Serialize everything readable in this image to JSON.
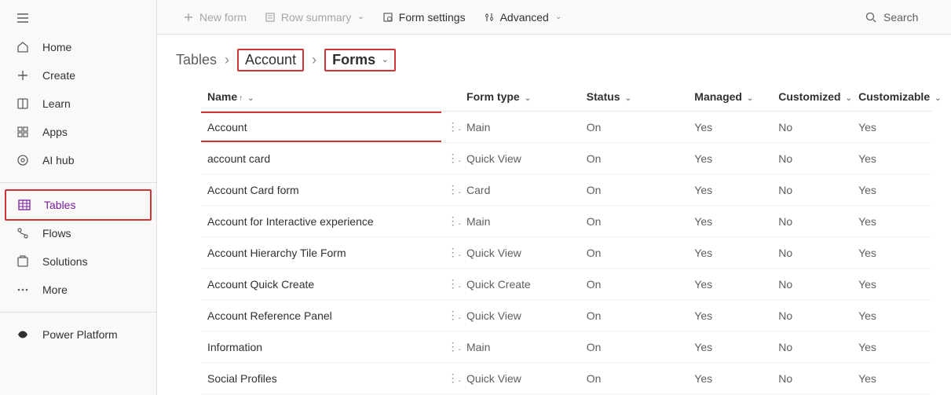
{
  "sidebar": {
    "items": [
      {
        "label": "Home",
        "icon": "home-icon"
      },
      {
        "label": "Create",
        "icon": "plus-icon"
      },
      {
        "label": "Learn",
        "icon": "book-icon"
      },
      {
        "label": "Apps",
        "icon": "apps-icon"
      },
      {
        "label": "AI hub",
        "icon": "aihub-icon"
      },
      {
        "label": "Tables",
        "icon": "tables-icon",
        "selected": true,
        "highlighted": true
      },
      {
        "label": "Flows",
        "icon": "flows-icon"
      },
      {
        "label": "Solutions",
        "icon": "solutions-icon"
      },
      {
        "label": "More",
        "icon": "more-icon"
      },
      {
        "label": "Power Platform",
        "icon": "powerplatform-icon"
      }
    ]
  },
  "commandbar": {
    "new_form": "New form",
    "row_summary": "Row summary",
    "form_settings": "Form settings",
    "advanced": "Advanced",
    "search_placeholder": "Search"
  },
  "breadcrumb": {
    "root": "Tables",
    "lvl1": "Account",
    "lvl2": "Forms"
  },
  "table": {
    "columns": {
      "name": "Name",
      "form_type": "Form type",
      "status": "Status",
      "managed": "Managed",
      "customized": "Customized",
      "customizable": "Customizable"
    },
    "rows": [
      {
        "name": "Account",
        "form_type": "Main",
        "status": "On",
        "managed": "Yes",
        "customized": "No",
        "customizable": "Yes",
        "highlighted": true
      },
      {
        "name": "account card",
        "form_type": "Quick View",
        "status": "On",
        "managed": "Yes",
        "customized": "No",
        "customizable": "Yes"
      },
      {
        "name": "Account Card form",
        "form_type": "Card",
        "status": "On",
        "managed": "Yes",
        "customized": "No",
        "customizable": "Yes"
      },
      {
        "name": "Account for Interactive experience",
        "form_type": "Main",
        "status": "On",
        "managed": "Yes",
        "customized": "No",
        "customizable": "Yes"
      },
      {
        "name": "Account Hierarchy Tile Form",
        "form_type": "Quick View",
        "status": "On",
        "managed": "Yes",
        "customized": "No",
        "customizable": "Yes"
      },
      {
        "name": "Account Quick Create",
        "form_type": "Quick Create",
        "status": "On",
        "managed": "Yes",
        "customized": "No",
        "customizable": "Yes"
      },
      {
        "name": "Account Reference Panel",
        "form_type": "Quick View",
        "status": "On",
        "managed": "Yes",
        "customized": "No",
        "customizable": "Yes"
      },
      {
        "name": "Information",
        "form_type": "Main",
        "status": "On",
        "managed": "Yes",
        "customized": "No",
        "customizable": "Yes"
      },
      {
        "name": "Social Profiles",
        "form_type": "Quick View",
        "status": "On",
        "managed": "Yes",
        "customized": "No",
        "customizable": "Yes"
      }
    ]
  }
}
